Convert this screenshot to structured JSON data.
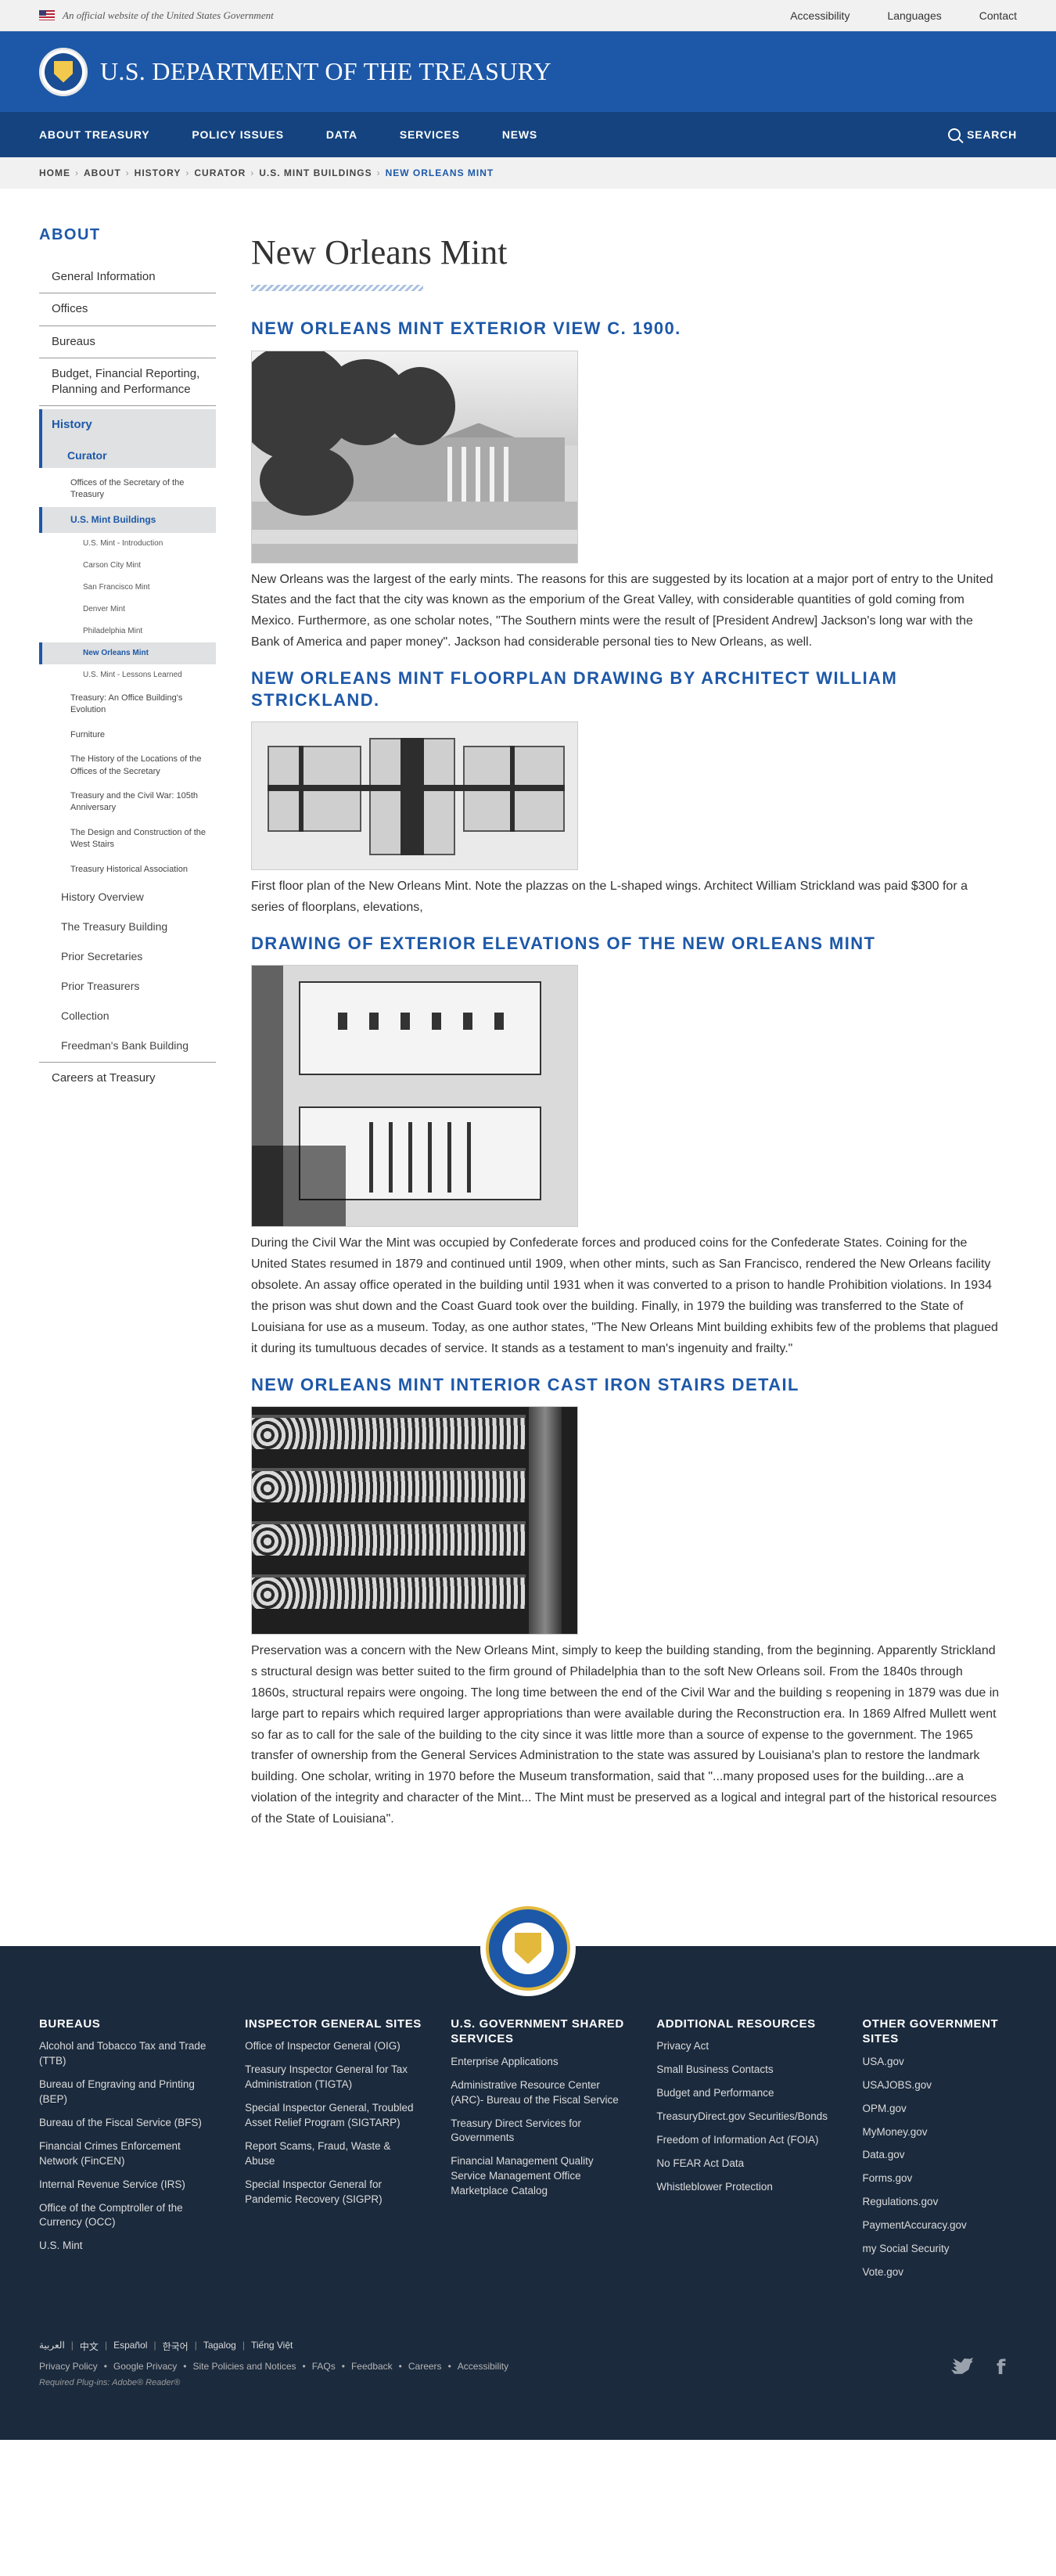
{
  "banner": {
    "official_text": "An official website of the United States Government",
    "links": [
      "Accessibility",
      "Languages",
      "Contact"
    ]
  },
  "header": {
    "title": "U.S. DEPARTMENT OF THE TREASURY"
  },
  "nav": {
    "items": [
      "ABOUT TREASURY",
      "POLICY ISSUES",
      "DATA",
      "SERVICES",
      "NEWS"
    ],
    "search_label": "SEARCH"
  },
  "breadcrumb": [
    "HOME",
    "ABOUT",
    "HISTORY",
    "CURATOR",
    "U.S. MINT BUILDINGS",
    "NEW ORLEANS MINT"
  ],
  "sidebar": {
    "heading": "ABOUT",
    "top_items": [
      "General Information",
      "Offices",
      "Bureaus",
      "Budget, Financial Reporting, Planning and Performance"
    ],
    "history": "History",
    "curator": "Curator",
    "curator_items_before": [
      "Offices of the Secretary of the Treasury"
    ],
    "mint_buildings": "U.S. Mint Buildings",
    "mint_items": [
      "U.S. Mint - Introduction",
      "Carson City Mint",
      "San Francisco Mint",
      "Denver Mint",
      "Philadelphia Mint",
      "New Orleans Mint",
      "U.S. Mint - Lessons Learned"
    ],
    "curator_items_after": [
      "Treasury: An Office Building's Evolution",
      "Furniture",
      "The History of the Locations of the Offices of the Secretary",
      "Treasury and the Civil War: 105th Anniversary",
      "The Design and Construction of the West Stairs",
      "Treasury Historical Association"
    ],
    "history_items": [
      "History Overview",
      "The Treasury Building",
      "Prior Secretaries",
      "Prior Treasurers",
      "Collection",
      "Freedman's Bank Building"
    ],
    "last_item": "Careers at Treasury"
  },
  "main": {
    "title": "New Orleans Mint",
    "sections": [
      {
        "heading": "NEW ORLEANS MINT EXTERIOR VIEW C. 1900.",
        "image_alt": "New Orleans Mint exterior view c. 1900",
        "text": "New Orleans was the largest of the early mints. The reasons for this are suggested by its location at a major port of entry to the United States and the fact that the city was known as the emporium of the Great Valley, with considerable quantities of gold coming from Mexico. Furthermore, as one scholar notes, \"The Southern mints were the result of [President Andrew] Jackson's long war with the Bank of America and paper money\". Jackson had considerable personal ties to New Orleans, as well."
      },
      {
        "heading": "NEW ORLEANS MINT FLOORPLAN DRAWING BY ARCHITECT WILLIAM STRICKLAND.",
        "image_alt": "Floorplan drawing",
        "text": "First floor plan of the New Orleans Mint. Note the plazzas on the L-shaped wings. Architect William Strickland was paid $300 for a series of floorplans, elevations,"
      },
      {
        "heading": "DRAWING OF EXTERIOR ELEVATIONS OF THE NEW ORLEANS MINT",
        "image_alt": "Exterior elevations drawing",
        "text": "During the Civil War the Mint was occupied by Confederate forces and produced coins for the Confederate States. Coining for the United States resumed in 1879 and continued until 1909, when other mints, such as San Francisco, rendered the New Orleans facility obsolete. An assay office operated in the building until 1931 when it was converted to a prison to handle Prohibition violations. In 1934 the prison was shut down and the Coast Guard took over the building. Finally, in 1979 the building was transferred to the State of Louisiana for use as a museum. Today, as one author states, \"The New Orleans Mint building exhibits few of the problems that plagued it during its tumultuous decades of service. It stands as a testament to man's ingenuity and frailty.\""
      },
      {
        "heading": "NEW ORLEANS MINT INTERIOR CAST IRON STAIRS DETAIL",
        "image_alt": "Interior cast iron stairs detail",
        "text": "Preservation was a concern with the New Orleans Mint, simply to keep the building standing, from the beginning. Apparently Strickland s structural design was better suited to the firm ground of Philadelphia than to the soft New Orleans soil. From the 1840s through 1860s, structural repairs were ongoing. The long time between the end of the Civil War and the building s reopening in 1879 was due in large part to repairs which required larger appropriations than were available during the Reconstruction era. In 1869 Alfred Mullett went so far as to call for the sale of the building to the city since it was little more than a source of expense to the government. The 1965 transfer of ownership from the General Services Administration to the state was assured by Louisiana's plan to restore the landmark building. One scholar, writing in 1970 before the Museum transformation, said that \"...many proposed uses for the building...are a violation of the integrity and character of the Mint... The Mint must be preserved as a logical and integral part of the historical resources of the State of Louisiana\"."
      }
    ]
  },
  "footer": {
    "seal_text": "THE DEPARTMENT OF THE TREASURY 1789",
    "columns": [
      {
        "heading": "BUREAUS",
        "links": [
          "Alcohol and Tobacco Tax and Trade (TTB)",
          "Bureau of Engraving and Printing (BEP)",
          "Bureau of the Fiscal Service (BFS)",
          "Financial Crimes Enforcement Network (FinCEN)",
          "Internal Revenue Service (IRS)",
          "Office of the Comptroller of the Currency (OCC)",
          "U.S. Mint"
        ]
      },
      {
        "heading": "INSPECTOR GENERAL SITES",
        "links": [
          "Office of Inspector General (OIG)",
          "Treasury Inspector General for Tax Administration (TIGTA)",
          "Special Inspector General, Troubled Asset Relief Program (SIGTARP)",
          "Report Scams, Fraud, Waste & Abuse",
          "Special Inspector General for Pandemic Recovery (SIGPR)"
        ]
      },
      {
        "heading": "U.S. GOVERNMENT SHARED SERVICES",
        "links": [
          "Enterprise Applications",
          "Administrative Resource Center (ARC)- Bureau of the Fiscal Service",
          "Treasury Direct Services for Governments",
          "Financial Management Quality Service Management Office Marketplace Catalog"
        ]
      },
      {
        "heading": "ADDITIONAL RESOURCES",
        "links": [
          "Privacy Act",
          "Small Business Contacts",
          "Budget and Performance",
          "TreasuryDirect.gov Securities/Bonds",
          "Freedom of Information Act (FOIA)",
          "No FEAR Act Data",
          "Whistleblower Protection"
        ]
      },
      {
        "heading": "OTHER GOVERNMENT SITES",
        "links": [
          "USA.gov",
          "USAJOBS.gov",
          "OPM.gov",
          "MyMoney.gov",
          "Data.gov",
          "Forms.gov",
          "Regulations.gov",
          "PaymentAccuracy.gov",
          "my Social Security",
          "Vote.gov"
        ]
      }
    ],
    "languages": [
      "العربية",
      "中文",
      "Español",
      "한국어",
      "Tagalog",
      "Tiếng Việt"
    ],
    "policies": [
      "Privacy Policy",
      "Google Privacy",
      "Site Policies and Notices",
      "FAQs",
      "Feedback",
      "Careers",
      "Accessibility"
    ],
    "plugins": "Required Plug-ins: Adobe® Reader®"
  },
  "colors": {
    "primary": "#1d58a8",
    "nav": "#14437f",
    "footer": "#1b2a3d",
    "accent_gold": "#e2b93b"
  }
}
